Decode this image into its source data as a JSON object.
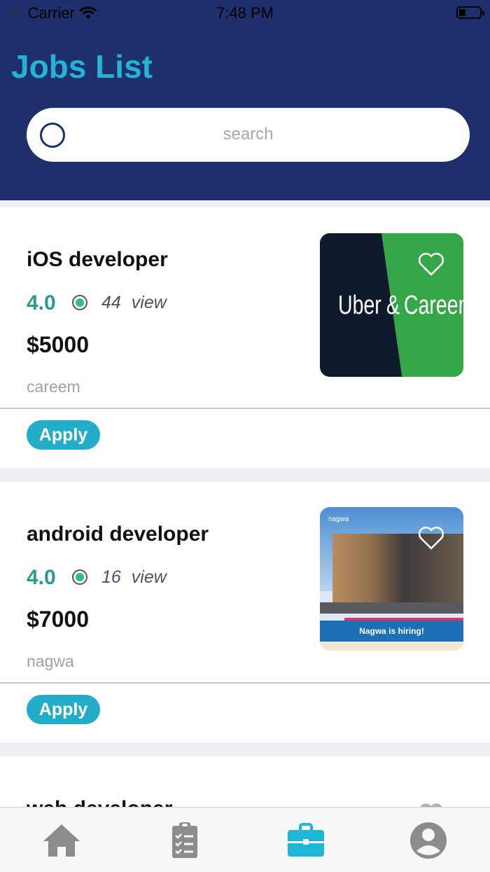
{
  "status": {
    "carrier": "Carrier",
    "time": "7:48 PM"
  },
  "header": {
    "title": "Jobs List"
  },
  "search": {
    "placeholder": "search"
  },
  "jobs": [
    {
      "title": "iOS developer",
      "rating": "4.0",
      "views_count": "44",
      "views_label": "view",
      "price": "$5000",
      "company": "careem",
      "apply": "Apply",
      "image_text_left": "Uber",
      "image_text_amp": "&",
      "image_text_right": "Careem"
    },
    {
      "title": "android developer",
      "rating": "4.0",
      "views_count": "16",
      "views_label": "view",
      "price": "$7000",
      "company": "nagwa",
      "apply": "Apply",
      "image_logo": "nagwa",
      "image_banner": "Nagwa is hiring!"
    },
    {
      "title": "web developer"
    }
  ],
  "tabs": [
    {
      "icon": "home-icon"
    },
    {
      "icon": "clipboard-icon"
    },
    {
      "icon": "briefcase-icon",
      "active": true
    },
    {
      "icon": "profile-icon"
    }
  ],
  "colors": {
    "header": "#1e2f6b",
    "accent": "#22b3d6",
    "rating": "#2a9d90",
    "apply": "#23adc8",
    "tab_active": "#1fb6d8",
    "tab_inactive": "#8c8c8c"
  }
}
